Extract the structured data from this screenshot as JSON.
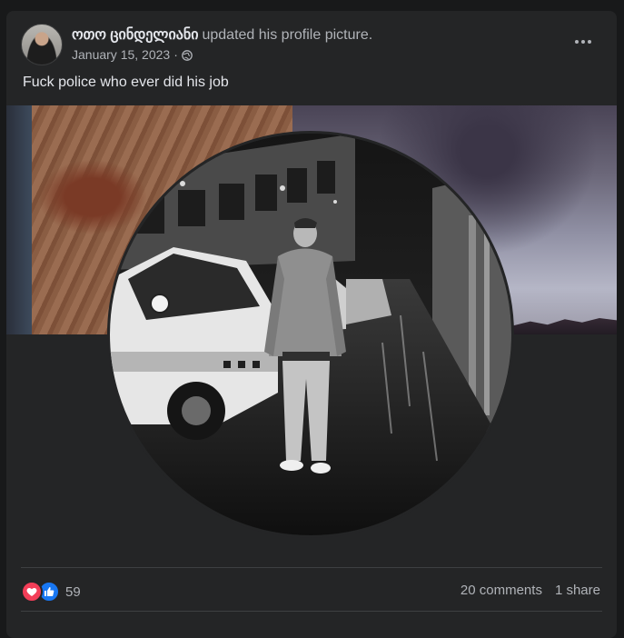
{
  "post": {
    "author_name": "ოთო ცინდელიანი",
    "action_text": "updated his profile picture.",
    "date": "January 15, 2023",
    "date_separator": "·",
    "privacy_icon": "globe-icon",
    "more_icon": "more-horizontal-icon",
    "body_text": "Fuck police who ever did his job"
  },
  "engagement": {
    "reaction_icons": [
      "love-reaction-icon",
      "like-reaction-icon"
    ],
    "reaction_count": "59",
    "comments": "20 comments",
    "shares": "1 share"
  },
  "colors": {
    "card_bg": "#242526",
    "page_bg": "#18191a",
    "primary_text": "#e4e6eb",
    "secondary_text": "#b0b3b8",
    "love": "#f33e58",
    "like": "#1877f2"
  }
}
